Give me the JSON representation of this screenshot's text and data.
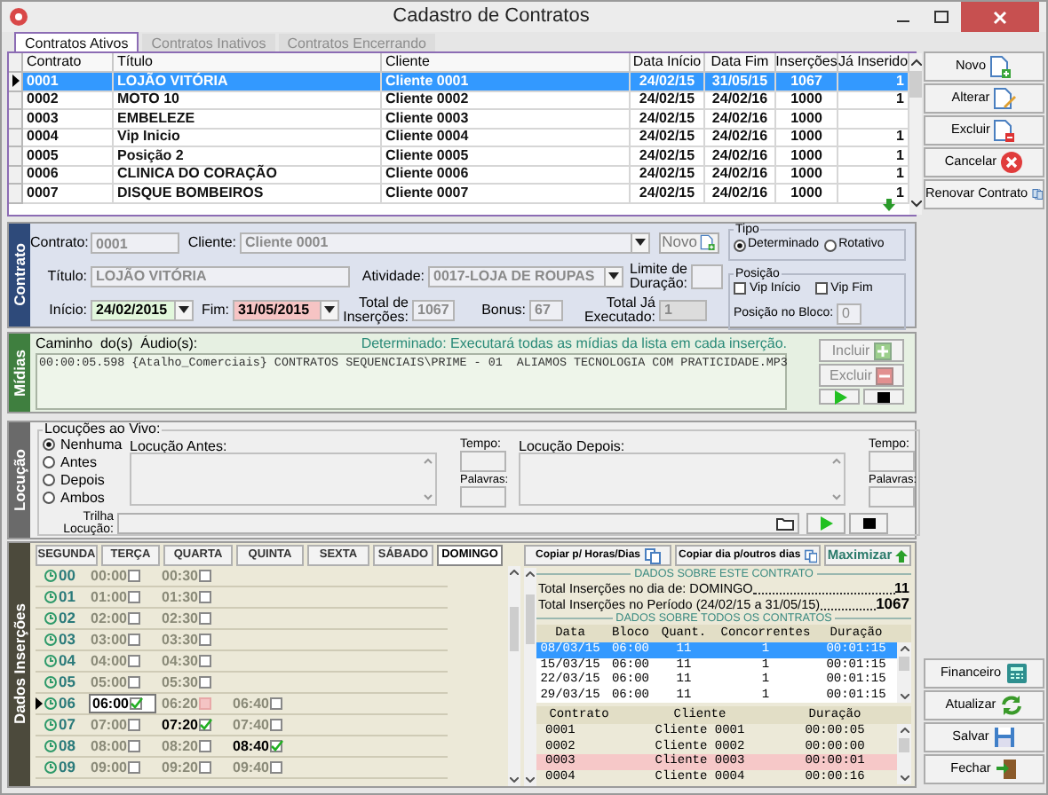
{
  "window": {
    "title": "Cadastro de Contratos"
  },
  "tabs": [
    {
      "label": "Contratos Ativos",
      "selected": true,
      "disabled": false
    },
    {
      "label": "Contratos Inativos",
      "selected": false,
      "disabled": true
    },
    {
      "label": "Contratos Encerrando",
      "selected": false,
      "disabled": true
    }
  ],
  "contracts_table": {
    "columns": [
      "Contrato",
      "Título",
      "Cliente",
      "Data Início",
      "Data Fim",
      "Inserções",
      "Já Inserido"
    ],
    "rows": [
      {
        "contrato": "0001",
        "titulo": "LOJÃO VITÓRIA",
        "cliente": "Cliente 0001",
        "inicio": "24/02/15",
        "fim": "31/05/15",
        "insercoes": "1067",
        "ja_inserido": "1",
        "selected": true
      },
      {
        "contrato": "0002",
        "titulo": "MOTO 10",
        "cliente": "Cliente 0002",
        "inicio": "24/02/15",
        "fim": "24/02/16",
        "insercoes": "1000",
        "ja_inserido": "1",
        "selected": false
      },
      {
        "contrato": "0003",
        "titulo": "EMBELEZE",
        "cliente": "Cliente 0003",
        "inicio": "24/02/15",
        "fim": "24/02/16",
        "insercoes": "1000",
        "selected": false
      },
      {
        "contrato": "0004",
        "titulo": "Vip Inicio",
        "cliente": "Cliente 0004",
        "inicio": "24/02/15",
        "fim": "24/02/16",
        "insercoes": "1000",
        "ja_inserido": "1",
        "selected": false
      },
      {
        "contrato": "0005",
        "titulo": "Posição 2",
        "cliente": "Cliente 0005",
        "inicio": "24/02/15",
        "fim": "24/02/16",
        "insercoes": "1000",
        "ja_inserido": "1",
        "selected": false
      },
      {
        "contrato": "0006",
        "titulo": "CLINICA DO CORAÇÃO",
        "cliente": "Cliente 0006",
        "inicio": "24/02/15",
        "fim": "24/02/16",
        "insercoes": "1000",
        "ja_inserido": "1",
        "selected": false
      },
      {
        "contrato": "0007",
        "titulo": "DISQUE BOMBEIROS",
        "cliente": "Cliente 0007",
        "inicio": "24/02/15",
        "fim": "24/02/16",
        "insercoes": "1000",
        "ja_inserido": "1",
        "selected": false
      }
    ]
  },
  "side_buttons": [
    {
      "label": "Novo",
      "kind": "new"
    },
    {
      "label": "Alterar",
      "kind": "edit"
    },
    {
      "label": "Excluir",
      "kind": "delete"
    },
    {
      "label": "Cancelar",
      "kind": "cancel"
    },
    {
      "label": "Renovar Contrato",
      "kind": "renew"
    }
  ],
  "contrato_panel": {
    "section_label": "Contrato",
    "contrato": {
      "label": "Contrato:",
      "value": "0001"
    },
    "cliente": {
      "label": "Cliente:",
      "value": "Cliente 0001"
    },
    "novo_button": "Novo",
    "tipo": {
      "legend": "Tipo",
      "options": [
        {
          "label": "Determinado",
          "selected": true
        },
        {
          "label": "Rotativo",
          "selected": false
        }
      ]
    },
    "titulo": {
      "label": "Título:",
      "value": "LOJÃO VITÓRIA"
    },
    "atividade": {
      "label": "Atividade:",
      "value": "0017-LOJA DE ROUPAS"
    },
    "limite": {
      "label": "Limite de Duração:"
    },
    "posicao": {
      "legend": "Posição",
      "options": [
        {
          "label": "Vip Início",
          "checked": false
        },
        {
          "label": "Vip Fim",
          "checked": false
        }
      ],
      "block_label": "Posição no Bloco:",
      "block_value": "0"
    },
    "inicio": {
      "label": "Início:",
      "value": "24/02/2015"
    },
    "fim": {
      "label": "Fim:",
      "value": "31/05/2015"
    },
    "total": {
      "label": "Total de Inserções:",
      "value": "1067"
    },
    "bonus": {
      "label": "Bonus:",
      "value": "67"
    },
    "executado": {
      "label": "Total Já Executado:",
      "value": "1"
    }
  },
  "midias": {
    "section_label": "Mídias",
    "path_label": "Caminho  do(s)  Áudio(s):",
    "note": "Determinado: Executará todas as mídias da lista em cada inserção.",
    "files": [
      "00:00:05.598 {Atalho_Comerciais} CONTRATOS SEQUENCIAIS\\PRIME - 01  ALIAMOS TECNOLOGIA COM PRATICIDADE.MP3"
    ],
    "buttons": [
      {
        "label": "Incluir",
        "kind": "add",
        "disabled": true
      },
      {
        "label": "Excluir",
        "kind": "remove",
        "disabled": true
      }
    ]
  },
  "locucao": {
    "section_label": "Locução",
    "legend": "Locuções ao Vivo:",
    "options": [
      {
        "label": "Nenhuma",
        "selected": true
      },
      {
        "label": "Antes",
        "selected": false
      },
      {
        "label": "Depois",
        "selected": false
      },
      {
        "label": "Ambos",
        "selected": false
      }
    ],
    "before": {
      "label": "Locução Antes:",
      "time_label": "Tempo:",
      "words_label": "Palavras:"
    },
    "after": {
      "label": "Locução Depois:",
      "time_label": "Tempo:",
      "words_label": "Palavras:"
    },
    "track_label": "Trilha Locução:"
  },
  "insercoes": {
    "section_label": "Dados Inserções",
    "days": [
      {
        "label": "SEGUNDA",
        "selected": false
      },
      {
        "label": "TERÇA",
        "selected": false
      },
      {
        "label": "QUARTA",
        "selected": false
      },
      {
        "label": "QUINTA",
        "selected": false
      },
      {
        "label": "SEXTA",
        "selected": false
      },
      {
        "label": "SÁBADO",
        "selected": false
      },
      {
        "label": "DOMINGO",
        "selected": true
      }
    ],
    "hours": [
      {
        "hour": "00",
        "current": false,
        "slots": [
          {
            "time": "00:00",
            "kind": "free"
          },
          {
            "time": "00:30",
            "kind": "free"
          }
        ]
      },
      {
        "hour": "01",
        "current": false,
        "slots": [
          {
            "time": "01:00",
            "kind": "free"
          },
          {
            "time": "01:30",
            "kind": "free"
          }
        ]
      },
      {
        "hour": "02",
        "current": false,
        "slots": [
          {
            "time": "02:00",
            "kind": "free"
          },
          {
            "time": "02:30",
            "kind": "free"
          }
        ]
      },
      {
        "hour": "03",
        "current": false,
        "slots": [
          {
            "time": "03:00",
            "kind": "free"
          },
          {
            "time": "03:30",
            "kind": "free"
          }
        ]
      },
      {
        "hour": "04",
        "current": false,
        "slots": [
          {
            "time": "04:00",
            "kind": "free"
          },
          {
            "time": "04:30",
            "kind": "free"
          }
        ]
      },
      {
        "hour": "05",
        "current": false,
        "slots": [
          {
            "time": "05:00",
            "kind": "free"
          },
          {
            "time": "05:30",
            "kind": "free"
          }
        ]
      },
      {
        "hour": "06",
        "current": true,
        "slots": [
          {
            "time": "06:00",
            "kind": "cursor"
          },
          {
            "time": "06:20",
            "kind": "blocked"
          },
          {
            "time": "06:40",
            "kind": "free"
          }
        ]
      },
      {
        "hour": "07",
        "current": false,
        "slots": [
          {
            "time": "07:00",
            "kind": "free"
          },
          {
            "time": "07:20",
            "kind": "inserted"
          },
          {
            "time": "07:40",
            "kind": "free"
          }
        ]
      },
      {
        "hour": "08",
        "current": false,
        "slots": [
          {
            "time": "08:00",
            "kind": "free"
          },
          {
            "time": "08:20",
            "kind": "free"
          },
          {
            "time": "08:40",
            "kind": "inserted"
          }
        ]
      },
      {
        "hour": "09",
        "current": false,
        "slots": [
          {
            "time": "09:00",
            "kind": "free"
          },
          {
            "time": "09:20",
            "kind": "free"
          },
          {
            "time": "09:40",
            "kind": "free"
          }
        ]
      }
    ],
    "copy_buttons": [
      "Copiar p/ Horas/Dias",
      "Copiar dia p/outros dias"
    ],
    "maximize_button": "Maximizar",
    "contract_stats": {
      "heading": "DADOS SOBRE ESTE CONTRATO",
      "lines": [
        {
          "label": "Total Inserções no dia de: DOMINGO",
          "value": "11"
        },
        {
          "label": "Total Inserções no Período (24/02/15 a 31/05/15)",
          "value": "1067"
        }
      ]
    },
    "all_stats": {
      "heading": "DADOS SOBRE TODOS OS CONTRATOS",
      "columns": [
        "Data",
        "Bloco",
        "Quant.",
        "Concorrentes",
        "Duração"
      ],
      "rows": [
        {
          "cells": [
            "08/03/15",
            "06:00",
            "11",
            "1",
            "00:01:15"
          ],
          "selected": true
        },
        {
          "cells": [
            "15/03/15",
            "06:00",
            "11",
            "1",
            "00:01:15"
          ],
          "selected": false
        },
        {
          "cells": [
            "22/03/15",
            "06:00",
            "11",
            "1",
            "00:01:15"
          ],
          "selected": false
        },
        {
          "cells": [
            "29/03/15",
            "06:00",
            "11",
            "1",
            "00:01:15"
          ],
          "selected": false
        }
      ]
    },
    "block_contracts": {
      "columns": [
        "Contrato",
        "Cliente",
        "Duração"
      ],
      "rows": [
        {
          "cells": [
            "0001",
            "Cliente 0001",
            "00:00:05"
          ],
          "highlighted": false
        },
        {
          "cells": [
            "0002",
            "Cliente 0002",
            "00:00:00"
          ],
          "highlighted": false
        },
        {
          "cells": [
            "0003",
            "Cliente 0003",
            "00:00:01"
          ],
          "highlighted": true
        },
        {
          "cells": [
            "0004",
            "Cliente 0004",
            "00:00:16"
          ],
          "highlighted": false
        }
      ]
    }
  },
  "bottom_buttons": [
    {
      "label": "Financeiro",
      "kind": "finance"
    },
    {
      "label": "Atualizar",
      "kind": "refresh"
    },
    {
      "label": "Salvar",
      "kind": "save"
    },
    {
      "label": "Fechar",
      "kind": "exit"
    }
  ]
}
